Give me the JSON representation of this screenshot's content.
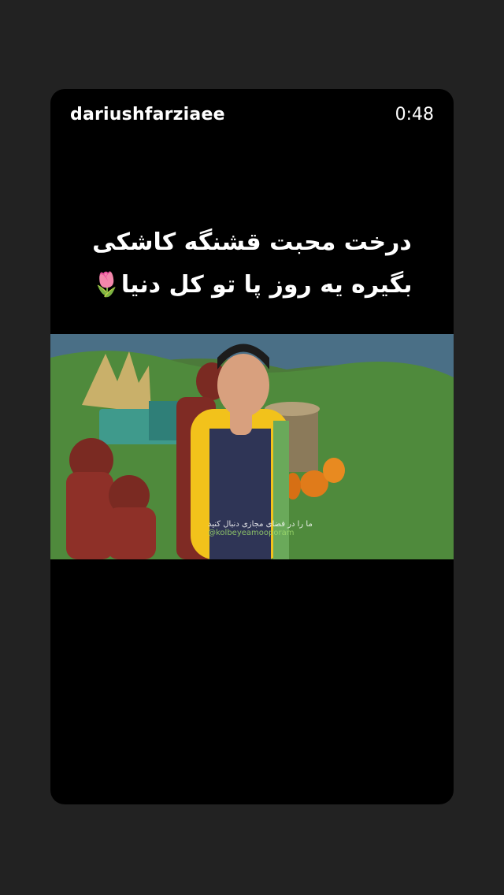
{
  "story": {
    "username": "dariushfarziaee",
    "duration": "0:48",
    "caption_line1": "درخت محبت قشنگه کاشکی",
    "caption_line2": "بگیره یه روز پا تو کل  دنیا🌷",
    "video": {
      "watermark_line1": "ما را در فضای مجازی دنبال کنید",
      "watermark_handle": "@kolbeyeamooporam"
    }
  }
}
